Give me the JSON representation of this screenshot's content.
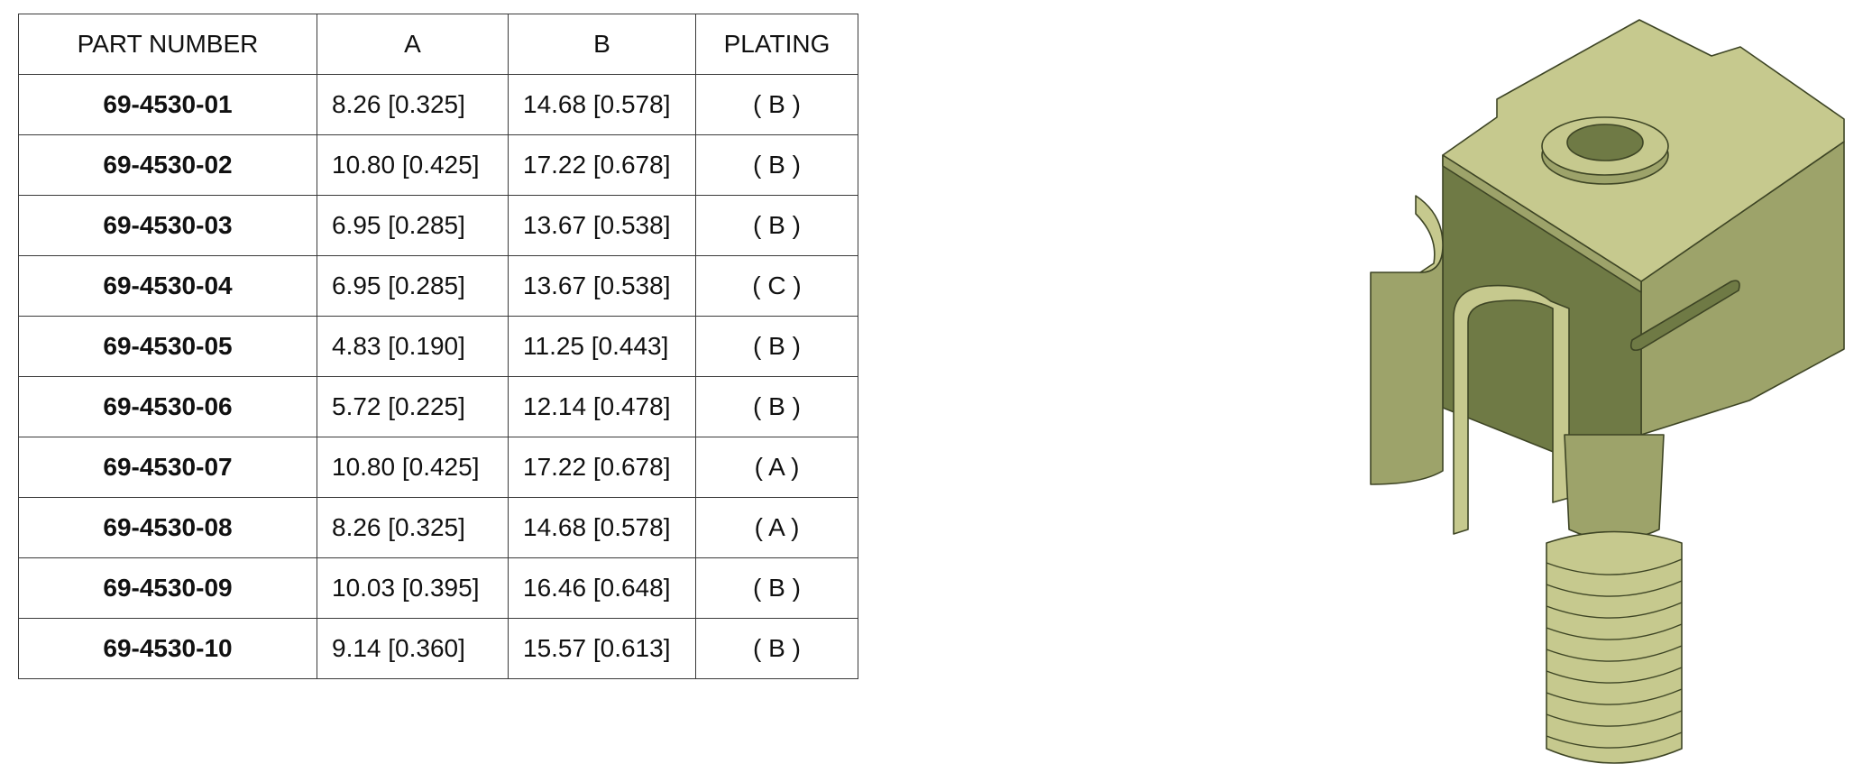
{
  "table": {
    "headers": [
      "PART NUMBER",
      "A",
      "B",
      "PLATING"
    ],
    "rows": [
      {
        "part": "69-4530-01",
        "a": "8.26 [0.325]",
        "b": "14.68 [0.578]",
        "plating": "( B )"
      },
      {
        "part": "69-4530-02",
        "a": "10.80 [0.425]",
        "b": "17.22 [0.678]",
        "plating": "( B )"
      },
      {
        "part": "69-4530-03",
        "a": "6.95 [0.285]",
        "b": "13.67 [0.538]",
        "plating": "( B )"
      },
      {
        "part": "69-4530-04",
        "a": "6.95 [0.285]",
        "b": "13.67 [0.538]",
        "plating": "( C )"
      },
      {
        "part": "69-4530-05",
        "a": "4.83 [0.190]",
        "b": "11.25 [0.443]",
        "plating": "( B )"
      },
      {
        "part": "69-4530-06",
        "a": "5.72 [0.225]",
        "b": "12.14 [0.478]",
        "plating": "( B )"
      },
      {
        "part": "69-4530-07",
        "a": "10.80 [0.425]",
        "b": "17.22 [0.678]",
        "plating": "(  A  )"
      },
      {
        "part": "69-4530-08",
        "a": "8.26 [0.325]",
        "b": "14.68 [0.578]",
        "plating": "(  A  )"
      },
      {
        "part": "69-4530-09",
        "a": "10.03 [0.395]",
        "b": "16.46 [0.648]",
        "plating": "(  B )"
      },
      {
        "part": "69-4530-10",
        "a": "9.14 [0.360]",
        "b": "15.57 [0.613]",
        "plating": "( B )"
      }
    ]
  },
  "image": {
    "icon": "threaded-clip-fastener-3d-render",
    "colors": {
      "top": "#c6c98e",
      "side": "#9da36a",
      "dark": "#6f7a45",
      "outline": "#3e4525"
    }
  }
}
